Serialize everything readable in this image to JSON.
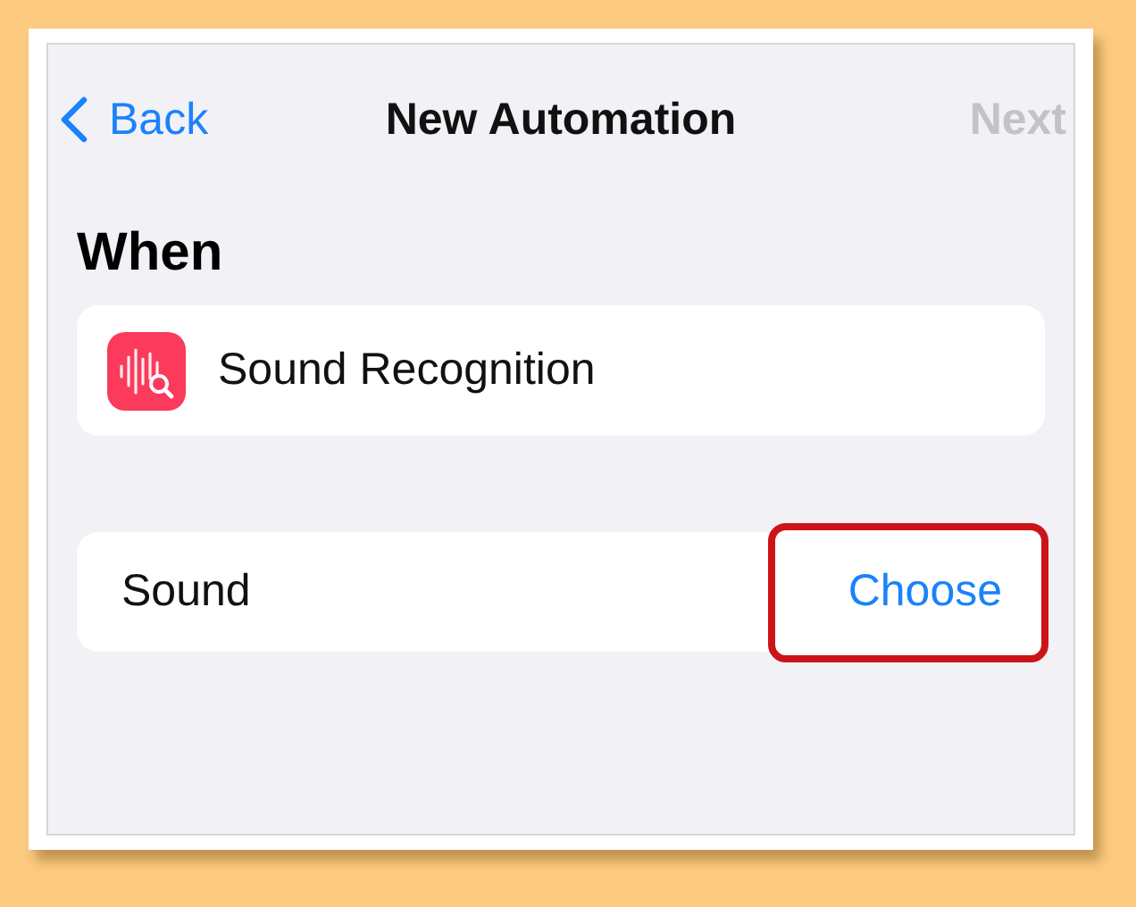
{
  "nav": {
    "back": "Back",
    "title": "New Automation",
    "next": {
      "label": "Next",
      "disabled": true
    }
  },
  "section": {
    "title": "When",
    "trigger": {
      "label": "Sound Recognition"
    }
  },
  "setting": {
    "label": "Sound",
    "action": "Choose",
    "highlighted": true
  }
}
